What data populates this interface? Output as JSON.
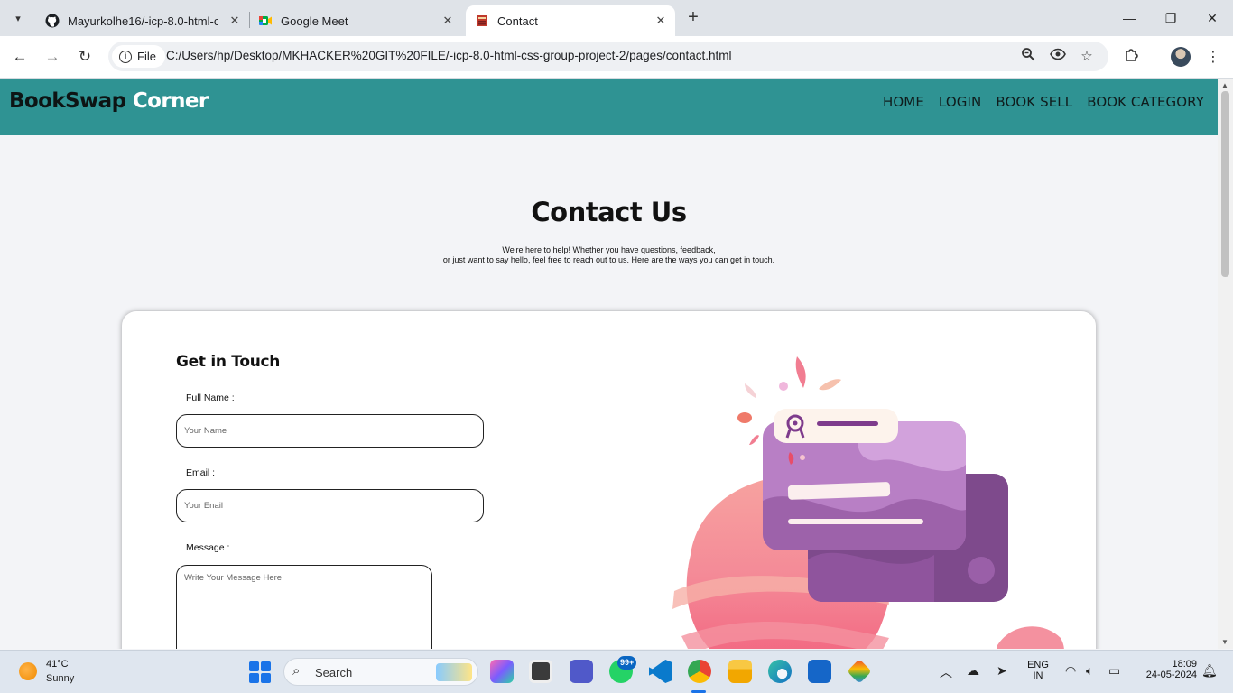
{
  "browser": {
    "tabs": [
      {
        "title": "Mayurkolhe16/-icp-8.0-html-css",
        "icon": "github-icon"
      },
      {
        "title": "Google Meet",
        "icon": "google-meet-icon"
      },
      {
        "title": "Contact",
        "icon": "book-favicon-icon",
        "active": true
      }
    ],
    "site_chip": "File",
    "url": "C:/Users/hp/Desktop/MKHACKER%20GIT%20FILE/-icp-8.0-html-css-group-project-2/pages/contact.html"
  },
  "site": {
    "brand_part1": "BookSwap",
    "brand_part2": "Corner",
    "nav": [
      "HOME",
      "LOGIN",
      "BOOK SELL",
      "BOOK CATEGORY"
    ]
  },
  "contact": {
    "title": "Contact Us",
    "intro_line1": "We're here to help! Whether you have questions, feedback,",
    "intro_line2": "or just want to say hello, feel free to reach out to us. Here are the ways you can get in touch.",
    "form_heading": "Get in Touch",
    "name_label": "Full Name :",
    "name_placeholder": "Your Name",
    "email_label": "Email :",
    "email_placeholder": "Your Enail",
    "message_label": "Message :",
    "message_placeholder": "Write Your Message Here"
  },
  "taskbar": {
    "temperature": "41°C",
    "weather": "Sunny",
    "search_label": "Search",
    "whatsapp_badge": "99+",
    "language_line1": "ENG",
    "language_line2": "IN",
    "time": "18:09",
    "date": "24-05-2024"
  },
  "colors": {
    "header_teal": "#2f9393",
    "page_bg": "#f3f4f7"
  }
}
